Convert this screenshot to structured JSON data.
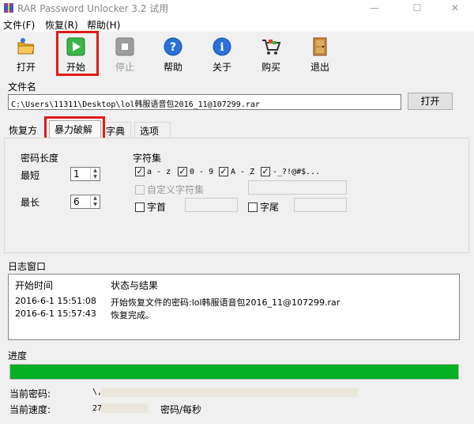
{
  "window": {
    "title": "RAR Password Unlocker 3.2 试用",
    "min": "—",
    "max": "☐",
    "close": "✕"
  },
  "menu": [
    "文件(F)",
    "恢复(R)",
    "帮助(H)"
  ],
  "toolbar": {
    "open": "打开",
    "start": "开始",
    "stop": "停止",
    "help": "帮助",
    "about": "关于",
    "buy": "购买",
    "exit": "退出"
  },
  "file": {
    "label": "文件名",
    "path": "C:\\Users\\11311\\Desktop\\lol韩服语音包2016_11@107299.rar",
    "open_button": "打开"
  },
  "tabs": [
    "恢复方式",
    "暴力破解",
    "字典",
    "选项"
  ],
  "brute": {
    "length_label": "密码长度",
    "min_label": "最短",
    "min_value": "1",
    "max_label": "最长",
    "max_value": "6",
    "charset_label": "字符集",
    "charsets": [
      "a - z",
      "0 - 9",
      "A - Z",
      "-_?!@#$..."
    ],
    "custom_label": "自定义字符集",
    "prefix_label": "字首",
    "suffix_label": "字尾"
  },
  "log": {
    "label": "日志窗口",
    "col_time": "开始时间",
    "col_status": "状态与结果",
    "rows": [
      {
        "time": "2016-6-1 15:51:08",
        "status": "开始恢复文件的密码:lol韩服语音包2016_11@107299.rar"
      },
      {
        "time": "2016-6-1 15:57:43",
        "status": "恢复完成。"
      }
    ]
  },
  "progress": {
    "label": "进度",
    "fraction": 1.0,
    "color": "#06b025"
  },
  "status": {
    "current_password_label": "当前密码:",
    "current_password": "\\,",
    "current_speed_label": "当前速度:",
    "current_speed": "27",
    "speed_unit": "密码/每秒"
  },
  "colors": {
    "highlight": "#e21b1b"
  }
}
